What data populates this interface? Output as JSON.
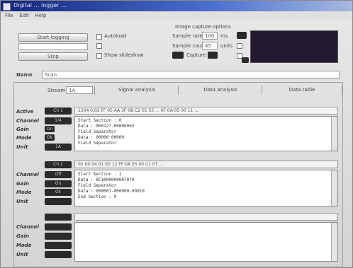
{
  "window": {
    "title": "Digital … logger …"
  },
  "menu": [
    "File",
    "Edit",
    "Help"
  ],
  "left_controls": {
    "start_button": "Start logging",
    "stop_button": "Stop",
    "status_field": "",
    "option1": "Autoload",
    "option2": "",
    "option3": "Show slideshow"
  },
  "capture": {
    "group_title": "Image capture options",
    "sample_rate_label": "Sample rate",
    "sample_rate_value": "100",
    "sample_rate_unit": "ms",
    "sample_count_label": "Sample count",
    "sample_count_value": "45",
    "sample_count_unit": "units",
    "format_label": "Capture"
  },
  "name_field": {
    "label": "Name",
    "value": "Scan"
  },
  "tabs": {
    "stream_label": "Stream",
    "stream_select": "1A",
    "labels": [
      "Signal analysis",
      "Data analysis",
      "Data table"
    ]
  },
  "channel_groups": [
    {
      "channel_btn": "Ch 1",
      "ticker": "1204 0,02 FF 05 AA 3F 0B C2 01 55 ...                 0F 0A 05 00 11 ...",
      "labels": [
        "Active",
        "Channel",
        "Gain",
        "Mode",
        "Unit"
      ],
      "chip_labels": [
        "1/4",
        "On",
        "Ok",
        "1A"
      ],
      "rows": [
        "Start Section : 0",
        "Data          : 000127-00000002",
        "Field Separator",
        "Data          : 00000 00000",
        "Field Separator"
      ]
    },
    {
      "channel_btn": "Ch 2",
      "ticker": "02 00 04 01 00 12 FF 0A 55 00 C1 07 ...",
      "labels": [
        "Channel",
        "Gain",
        "Mode",
        "Unit"
      ],
      "chip_labels": [
        "Off",
        "On",
        "Ok"
      ],
      "rows": [
        "Start Section : 1",
        "Data          : 0C1000000007070",
        "Field Separator",
        "Data          : 000001-000000-00010",
        "End Section   : 0"
      ]
    },
    {
      "labels": [
        "Channel",
        "Gain",
        "Mode",
        "Unit"
      ],
      "rows": []
    }
  ]
}
